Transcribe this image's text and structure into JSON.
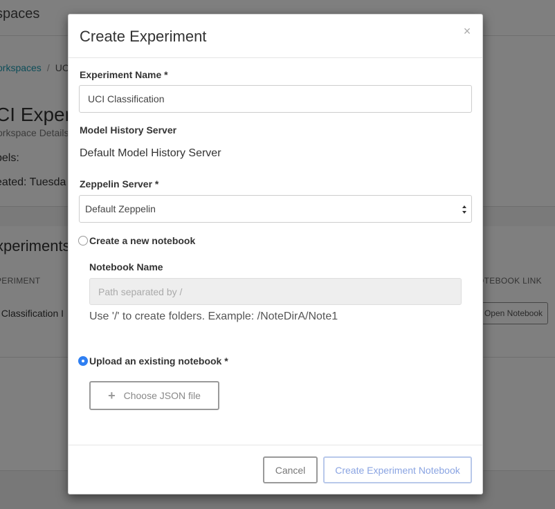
{
  "background": {
    "header_title": "spaces",
    "breadcrumb": {
      "link": "orkspaces",
      "separator": "/",
      "current": "UC"
    },
    "page_title": "CI Exper",
    "subtitle": "orkspace Details",
    "labels_text": "bels:",
    "created_text": "eated: Tuesda",
    "experiments_title": "xperiments",
    "table": {
      "col_experiment": "PERIMENT",
      "col_notebook_link": "OTEBOOK LINK",
      "row_name": "I Classification I",
      "open_notebook_label": "Open Notebook"
    }
  },
  "modal": {
    "title": "Create Experiment",
    "close_glyph": "×",
    "experiment_name": {
      "label": "Experiment Name *",
      "value": "UCI Classification"
    },
    "model_history": {
      "label": "Model History Server",
      "value": "Default Model History Server"
    },
    "zeppelin": {
      "label": "Zeppelin Server *",
      "selected": "Default Zeppelin"
    },
    "new_notebook": {
      "radio_label": "Create a new notebook",
      "checked": false,
      "name_label": "Notebook Name",
      "placeholder": "Path separated by /",
      "help": "Use '/' to create folders. Example: /NoteDirA/Note1"
    },
    "upload_notebook": {
      "radio_label": "Upload an existing notebook *",
      "checked": true,
      "file_button_label": "Choose JSON file",
      "plus_glyph": "+"
    },
    "footer": {
      "cancel_label": "Cancel",
      "create_label": "Create Experiment Notebook"
    }
  },
  "colors": {
    "radio_checked": "#2f7ff2",
    "primary_button_text": "#8aa4e2",
    "link": "#1a9ab2"
  }
}
